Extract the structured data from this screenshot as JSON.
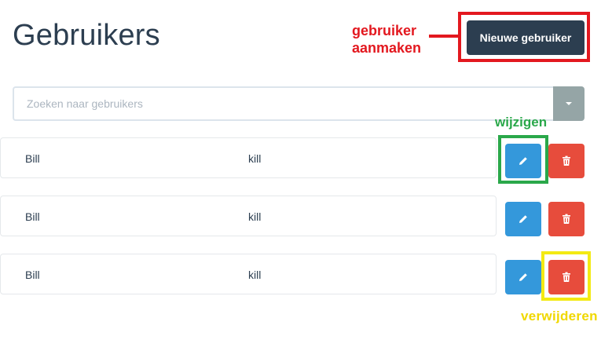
{
  "page": {
    "title": "Gebruikers"
  },
  "header": {
    "new_user_label": "Nieuwe gebruiker"
  },
  "search": {
    "placeholder": "Zoeken naar gebruikers",
    "toggle_icon": "caret-down-icon"
  },
  "users": {
    "rows": [
      {
        "first": "Bill",
        "second": "kill"
      },
      {
        "first": "Bill",
        "second": "kill"
      },
      {
        "first": "Bill",
        "second": "kill"
      }
    ],
    "edit_icon": "pencil-icon",
    "delete_icon": "trash-icon"
  },
  "annotations": {
    "create": {
      "line1": "gebruiker",
      "line2": "aanmaken",
      "color": "#e3181f"
    },
    "edit": {
      "text": "wijzigen",
      "color": "#2aa84a"
    },
    "delete": {
      "text": "verwijderen",
      "color": "#f0d800"
    }
  },
  "colors": {
    "primary_dark": "#2c3e50",
    "edit_blue": "#3498db",
    "delete_red": "#e74c3c",
    "toggle_gray": "#95a5a6"
  }
}
